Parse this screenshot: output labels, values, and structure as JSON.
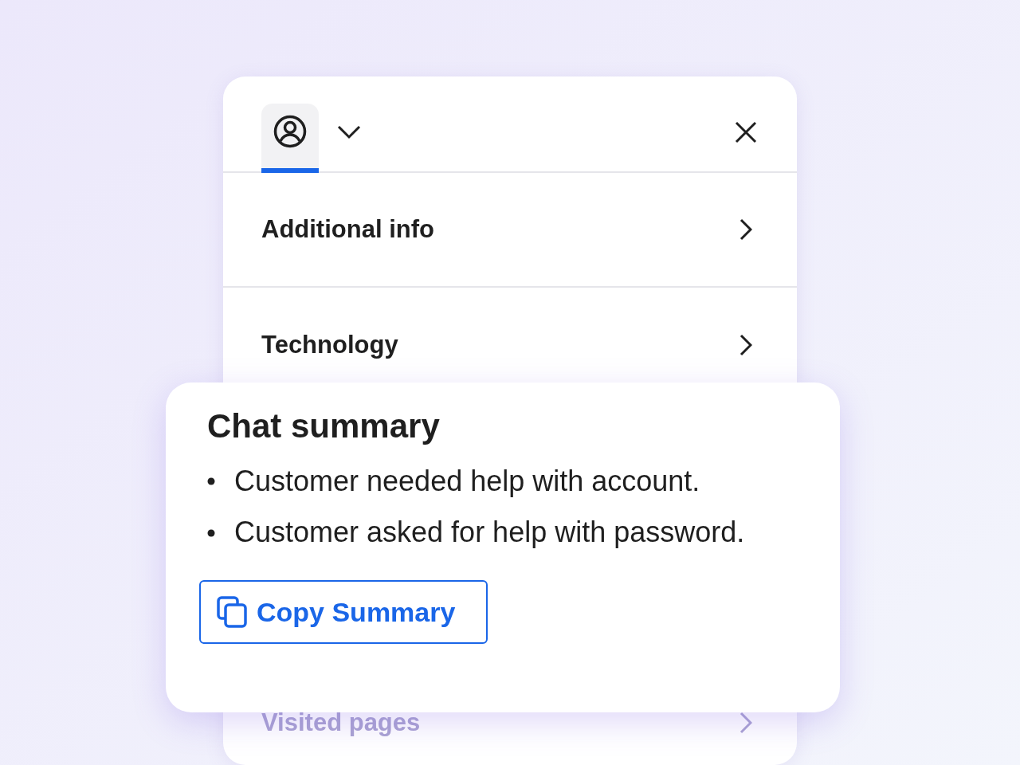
{
  "panel": {
    "tabs": [
      {
        "kind": "profile",
        "selected": true
      }
    ],
    "rows": [
      {
        "label": "Additional info",
        "faded": false
      },
      {
        "label": "Technology",
        "faded": false
      },
      {
        "label": "Visited pages",
        "faded": true
      }
    ]
  },
  "summary_card": {
    "title": "Chat summary",
    "bullets": [
      "Customer needed help with account.",
      "Customer asked for help with password."
    ],
    "button": "Copy Summary"
  }
}
